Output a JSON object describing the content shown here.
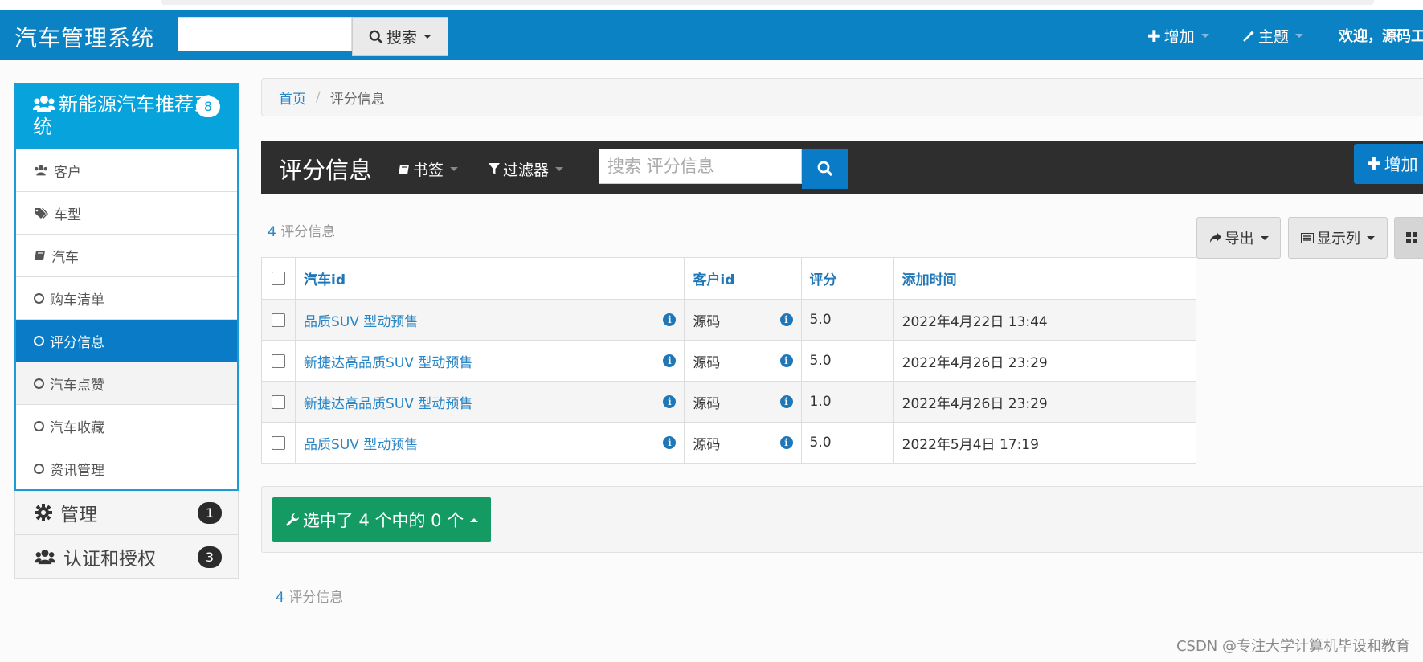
{
  "navbar": {
    "brand": "汽车管理系统",
    "search_button": "搜索",
    "add_menu": "增加",
    "theme_menu": "主题",
    "welcome": "欢迎，源码工"
  },
  "sidebar": {
    "section_title": "新能源汽车推荐系统",
    "section_badge": "8",
    "items": [
      {
        "label": "客户",
        "icon": "users-icon"
      },
      {
        "label": "车型",
        "icon": "tags-icon"
      },
      {
        "label": "汽车",
        "icon": "book-icon"
      },
      {
        "label": "购车清单",
        "icon": "circle-icon"
      },
      {
        "label": "评分信息",
        "icon": "circle-icon",
        "active": true
      },
      {
        "label": "汽车点赞",
        "icon": "circle-icon"
      },
      {
        "label": "汽车收藏",
        "icon": "circle-icon"
      },
      {
        "label": "资讯管理",
        "icon": "circle-icon"
      }
    ],
    "groups": [
      {
        "label": "管理",
        "badge": "1",
        "icon": "gear-icon"
      },
      {
        "label": "认证和授权",
        "badge": "3",
        "icon": "users-icon"
      }
    ]
  },
  "breadcrumb": {
    "home": "首页",
    "current": "评分信息"
  },
  "list": {
    "title": "评分信息",
    "bookmark": "书签",
    "filter": "过滤器",
    "search_placeholder": "搜索 评分信息",
    "add_button": "增加",
    "count_num": "4",
    "count_label": "评分信息",
    "export_button": "导出",
    "columns_button": "显示列",
    "headers": [
      "汽车id",
      "客户id",
      "评分",
      "添加时间"
    ],
    "rows": [
      {
        "car": "品质SUV 型动预售",
        "customer": "源码",
        "score": "5.0",
        "time": "2022年4月22日 13:44"
      },
      {
        "car": "新捷达高品质SUV 型动预售",
        "customer": "源码",
        "score": "5.0",
        "time": "2022年4月26日 23:29"
      },
      {
        "car": "新捷达高品质SUV 型动预售",
        "customer": "源码",
        "score": "1.0",
        "time": "2022年4月26日 23:29"
      },
      {
        "car": "品质SUV 型动预售",
        "customer": "源码",
        "score": "5.0",
        "time": "2022年5月4日 17:19"
      }
    ],
    "bulk_action": "选中了 4 个中的 0 个",
    "footer_count_num": "4",
    "footer_count_label": "评分信息"
  },
  "watermark": "CSDN @专注大学计算机毕设和教育",
  "colors": {
    "navbar": "#0a82c3",
    "sidebar_header": "#06a3dc",
    "active_item": "#0a7cc7",
    "bulk_button": "#149a63",
    "list_header": "#2e2e2e"
  }
}
